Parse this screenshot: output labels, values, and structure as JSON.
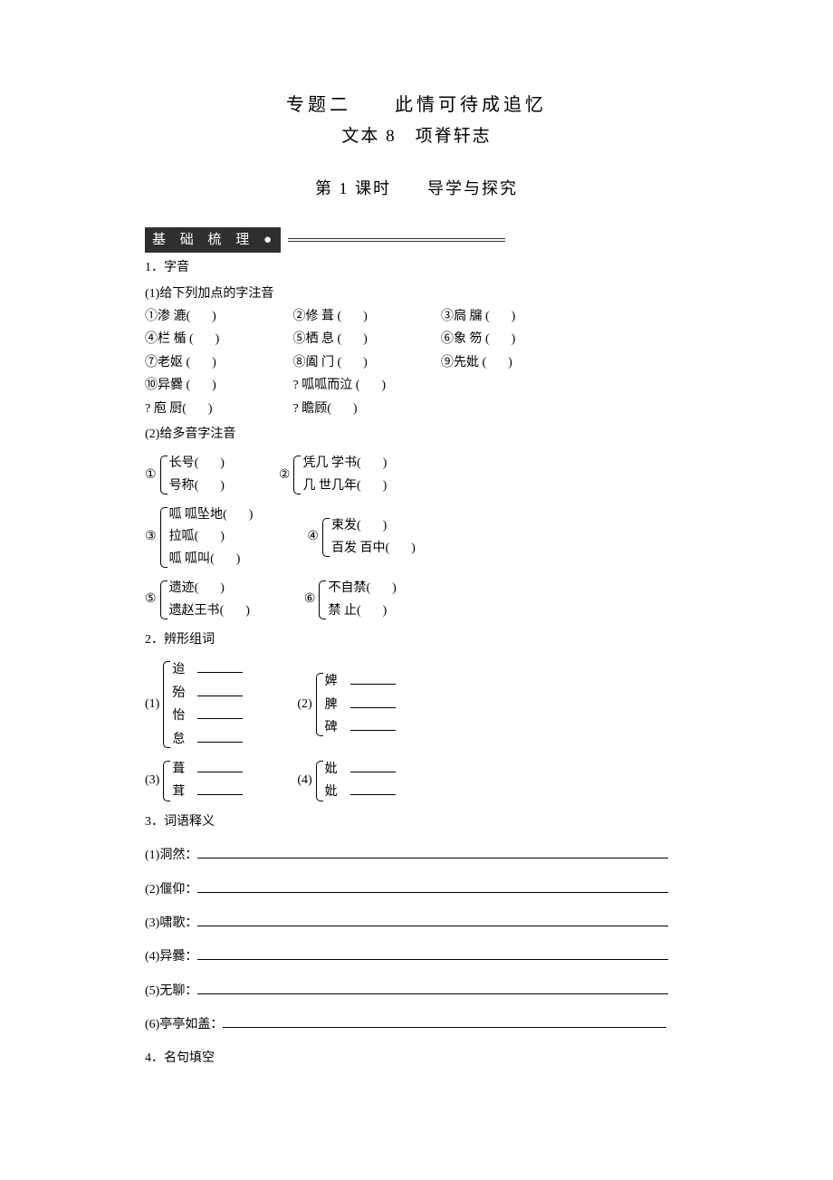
{
  "titles": {
    "main": "专题二　　此情可待成追忆",
    "sub": "文本 8　项脊轩志",
    "lesson": "第 1 课时　　导学与探究"
  },
  "sectionBanner": "基 础 梳 理",
  "h1": "1．字音",
  "h1_1": "(1)给下列加点的字注音",
  "ziyin_items": [
    "①渗 漉",
    "②修 葺",
    "③扃 牖",
    "④栏 楯",
    "⑤栖 息",
    "⑥象 笏",
    "⑦老妪",
    "⑧阖 门",
    "⑨先妣",
    "⑩异爨",
    "? 呱呱而泣",
    "? 庖 厨",
    "? 瞻顾"
  ],
  "h1_2": "(2)给多音字注音",
  "poly": [
    {
      "num": "①",
      "left": [
        "长号",
        "号称"
      ],
      "numR": "②",
      "right": [
        "凭几 学书",
        "几 世几年"
      ]
    },
    {
      "num": "③",
      "left": [
        "呱 呱坠地",
        "拉呱",
        "呱 呱叫"
      ],
      "numR": "④",
      "right": [
        "束发",
        "百发 百中"
      ]
    },
    {
      "num": "⑤",
      "left": [
        "遗迹",
        "遗赵王书"
      ],
      "numR": "⑥",
      "right": [
        "不自禁",
        "禁 止"
      ]
    }
  ],
  "h2": "2．辨形组词",
  "bianxing": [
    {
      "num": "(1)",
      "left": [
        "迨",
        "殆",
        "怡",
        "怠"
      ],
      "numR": "(2)",
      "right": [
        "婢",
        "脾",
        "碑"
      ]
    },
    {
      "num": "(3)",
      "left": [
        "葺",
        "茸"
      ],
      "numR": "(4)",
      "right": [
        "妣",
        "妣"
      ]
    }
  ],
  "h3": "3．词语释义",
  "defs": [
    "(1)洞然：",
    "(2)偃仰：",
    "(3)啸歌：",
    "(4)异爨：",
    "(5)无聊：",
    "(6)亭亭如盖："
  ],
  "h4": "4．名句填空"
}
